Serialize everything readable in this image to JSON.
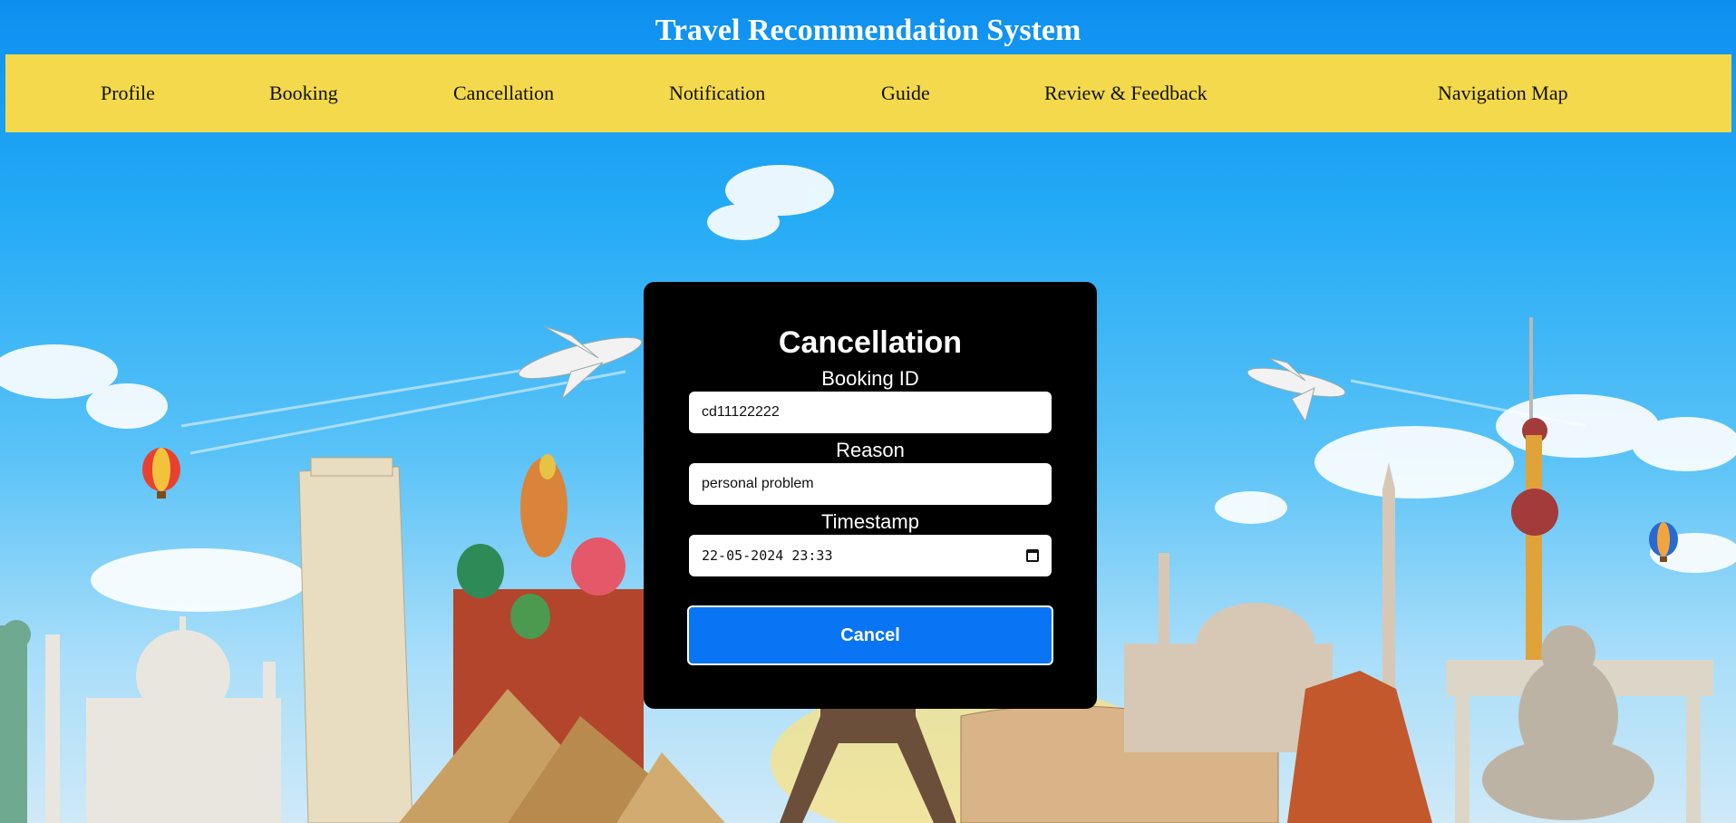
{
  "app": {
    "title": "Travel Recommendation System"
  },
  "nav": {
    "items": [
      {
        "label": "Profile"
      },
      {
        "label": "Booking"
      },
      {
        "label": "Cancellation"
      },
      {
        "label": "Notification"
      },
      {
        "label": "Guide"
      },
      {
        "label": "Review & Feedback"
      },
      {
        "label": "Navigation Map"
      }
    ]
  },
  "form": {
    "title": "Cancellation",
    "booking_id": {
      "label": "Booking ID",
      "value": "cd11122222"
    },
    "reason": {
      "label": "Reason",
      "value": "personal problem"
    },
    "timestamp": {
      "label": "Timestamp",
      "value": "22-05-2024 23:33",
      "icon": "calendar-icon"
    },
    "submit_label": "Cancel"
  },
  "colors": {
    "nav_background": "#f3d94b",
    "card_background": "#000000",
    "button": "#0a75f4",
    "sky_top": "#0d8ff0"
  }
}
